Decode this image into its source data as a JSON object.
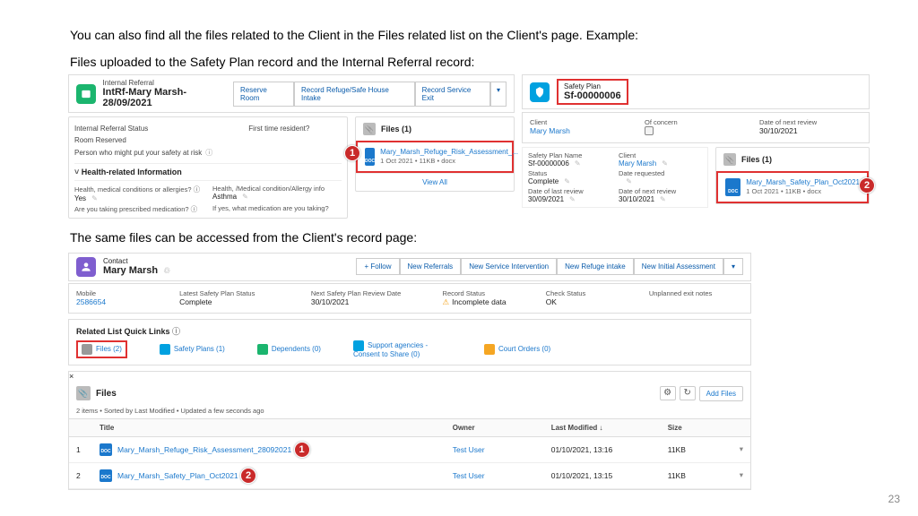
{
  "text": {
    "intro": "You can also find all the files related to the Client in the Files related list on the Client's page. Example:",
    "sub": "Files uploaded to the Safety Plan record and the Internal Referral record:",
    "same": "The same files can be accessed from the Client's record page:",
    "page": "23"
  },
  "intref": {
    "type": "Internal Referral",
    "name": "IntRf-Mary Marsh-28/09/2021",
    "buttons": [
      "Reserve Room",
      "Record Refuge/Safe House Intake",
      "Record Service Exit"
    ],
    "fields": {
      "status_lbl": "Internal Referral Status",
      "room_lbl": "Room Reserved",
      "risk_lbl": "Person who might put your safety at risk",
      "first_lbl": "First time resident?",
      "section": "Health-related Information",
      "q1": "Health, medical conditions or allergies?",
      "a1": "Yes",
      "q2": "Health, /Medical condition/Allergy info",
      "a2": "Asthma",
      "q3": "Are you taking prescribed medication?",
      "q4": "If yes, what medication are you taking?"
    },
    "files": {
      "header": "Files (1)",
      "name": "Mary_Marsh_Refuge_Risk_Assessment_...",
      "meta": "1 Oct 2021 • 11KB • docx",
      "viewall": "View All"
    }
  },
  "sp": {
    "type": "Safety Plan",
    "name": "Sf-00000006",
    "top": {
      "client_k": "Client",
      "client_v": "Mary Marsh",
      "concern_k": "Of concern",
      "next_k": "Date of next review",
      "next_v": "30/10/2021"
    },
    "det": {
      "spn_k": "Safety Plan Name",
      "spn_v": "Sf-00000006",
      "cli_k": "Client",
      "cli_v": "Mary Marsh",
      "st_k": "Status",
      "st_v": "Complete",
      "dr_k": "Date requested",
      "dl_k": "Date of last review",
      "dl_v": "30/09/2021",
      "dn_k": "Date of next review",
      "dn_v": "30/10/2021"
    },
    "files": {
      "header": "Files (1)",
      "name": "Mary_Marsh_Safety_Plan_Oct2021",
      "meta": "1 Oct 2021 • 11KB • docx"
    }
  },
  "contact": {
    "type": "Contact",
    "name": "Mary Marsh",
    "buttons": [
      "+ Follow",
      "New Referrals",
      "New Service Intervention",
      "New Refuge intake",
      "New Initial Assessment"
    ],
    "row": {
      "mob_k": "Mobile",
      "mob_v": "2586654",
      "sps_k": "Latest Safety Plan Status",
      "sps_v": "Complete",
      "nrd_k": "Next Safety Plan Review Date",
      "nrd_v": "30/10/2021",
      "rs_k": "Record Status",
      "rs_v": "Incomplete data",
      "cs_k": "Check Status",
      "cs_v": "OK",
      "un_k": "Unplanned exit notes"
    },
    "rlq_title": "Related List Quick Links",
    "rlq": [
      "Files (2)",
      "Safety Plans (1)",
      "Dependents (0)",
      "Support agencies - Consent to Share (0)",
      "Court Orders (0)"
    ],
    "ftable": {
      "title": "Files",
      "sub": "2 items • Sorted by Last Modified • Updated a few seconds ago",
      "addfiles": "Add Files",
      "cols": [
        "",
        "Title",
        "Owner",
        "Last Modified ↓",
        "Size",
        ""
      ],
      "rows": [
        {
          "n": "1",
          "title": "Mary_Marsh_Refuge_Risk_Assessment_28092021",
          "owner": "Test User",
          "mod": "01/10/2021, 13:16",
          "size": "11KB"
        },
        {
          "n": "2",
          "title": "Mary_Marsh_Safety_Plan_Oct2021",
          "owner": "Test User",
          "mod": "01/10/2021, 13:15",
          "size": "11KB"
        }
      ]
    }
  }
}
